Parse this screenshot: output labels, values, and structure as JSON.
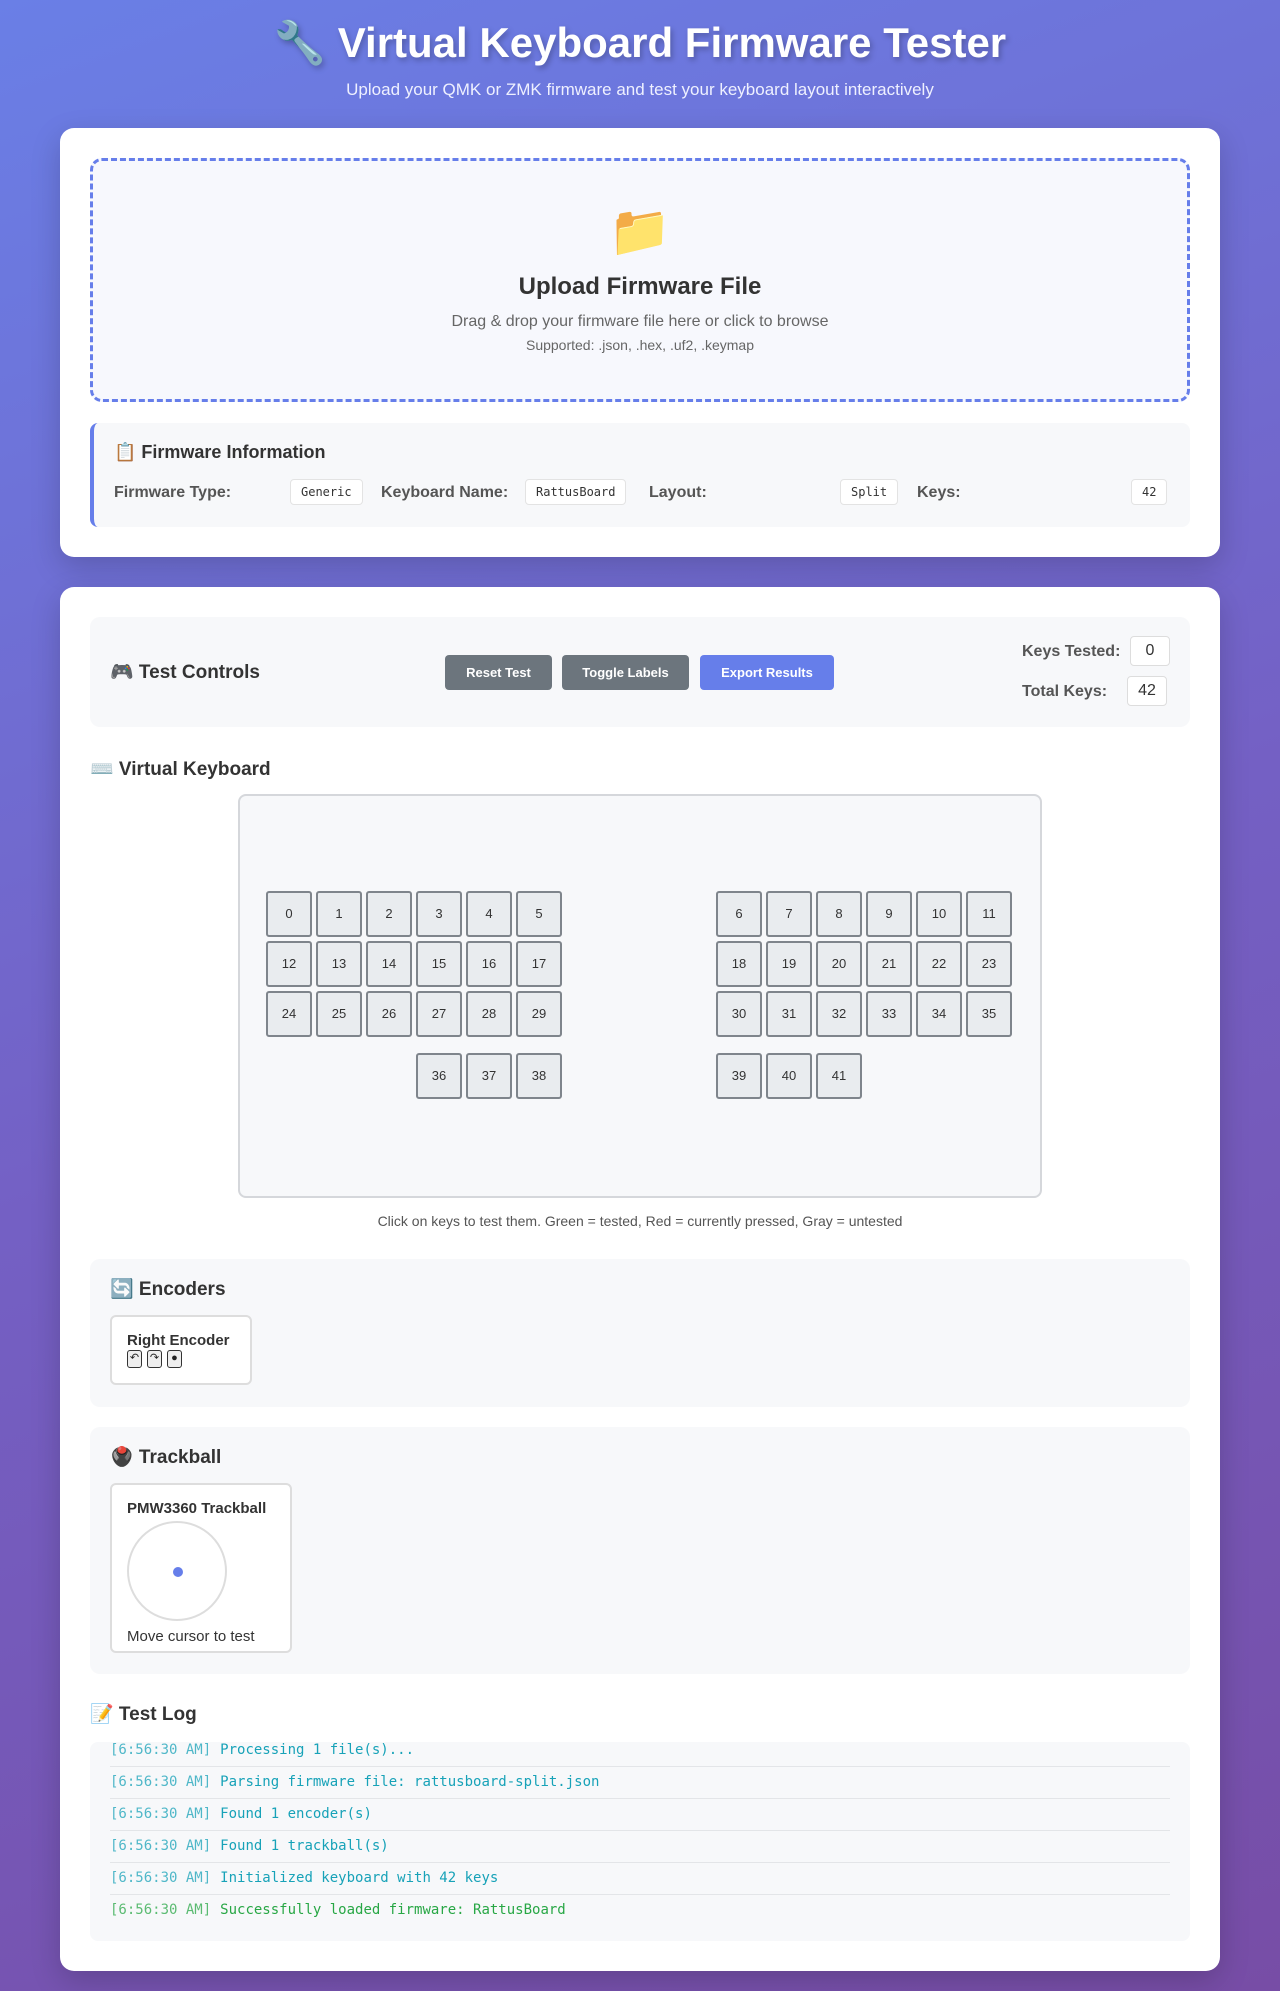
{
  "header": {
    "title": "🔧 Virtual Keyboard Firmware Tester",
    "subtitle": "Upload your QMK or ZMK firmware and test your keyboard layout interactively"
  },
  "upload": {
    "icon": "folder-icon",
    "icon_glyph": "📁",
    "title": "Upload Firmware File",
    "description": "Drag & drop your firmware file here or click to browse",
    "supported": "Supported: .json, .hex, .uf2, .keymap"
  },
  "firmware_info": {
    "title": "📋 Firmware Information",
    "fields": [
      {
        "label": "Firmware Type:",
        "value": "Generic"
      },
      {
        "label": "Keyboard Name:",
        "value": "RattusBoard"
      },
      {
        "label": "Layout:",
        "value": "Split"
      },
      {
        "label": "Keys:",
        "value": "42"
      }
    ]
  },
  "controls": {
    "title": "🎮 Test Controls",
    "buttons": {
      "reset": "Reset Test",
      "toggle": "Toggle Labels",
      "export": "Export Results"
    },
    "keys_tested_label": "Keys Tested:",
    "keys_tested": "0",
    "total_keys_label": "Total Keys:",
    "total_keys": "42"
  },
  "keyboard": {
    "title": "⌨️ Virtual Keyboard",
    "keys": [
      "0",
      "1",
      "2",
      "3",
      "4",
      "5",
      "6",
      "7",
      "8",
      "9",
      "10",
      "11",
      "12",
      "13",
      "14",
      "15",
      "16",
      "17",
      "18",
      "19",
      "20",
      "21",
      "22",
      "23",
      "24",
      "25",
      "26",
      "27",
      "28",
      "29",
      "30",
      "31",
      "32",
      "33",
      "34",
      "35",
      "36",
      "37",
      "38",
      "39",
      "40",
      "41"
    ],
    "hint": "Click on keys to test them. Green = tested, Red = currently pressed, Gray = untested",
    "colors": {
      "untested": "#e9ecef",
      "tested": "#28a745",
      "pressed": "#dc3545"
    }
  },
  "encoders": {
    "title": "🔄 Encoders",
    "items": [
      {
        "name": "Right Encoder",
        "buttons": [
          "↶",
          "↷",
          "●"
        ]
      }
    ]
  },
  "trackball": {
    "title": "🖲️ Trackball",
    "name": "PMW3360 Trackball",
    "hint": "Move cursor to test"
  },
  "log": {
    "title": "📝 Test Log",
    "entries": [
      {
        "time": "[6:56:30 AM]",
        "message": "Processing 1 file(s)...",
        "type": "info"
      },
      {
        "time": "[6:56:30 AM]",
        "message": "Parsing firmware file: rattusboard-split.json",
        "type": "info"
      },
      {
        "time": "[6:56:30 AM]",
        "message": "Found 1 encoder(s)",
        "type": "info"
      },
      {
        "time": "[6:56:30 AM]",
        "message": "Found 1 trackball(s)",
        "type": "info"
      },
      {
        "time": "[6:56:30 AM]",
        "message": "Initialized keyboard with 42 keys",
        "type": "info"
      },
      {
        "time": "[6:56:30 AM]",
        "message": "Successfully loaded firmware: RattusBoard",
        "type": "success"
      }
    ]
  },
  "theme": {
    "accent": "#667eea",
    "button_gray": "#6c757d",
    "log_info": "#17a2b8",
    "log_success": "#28a745"
  }
}
